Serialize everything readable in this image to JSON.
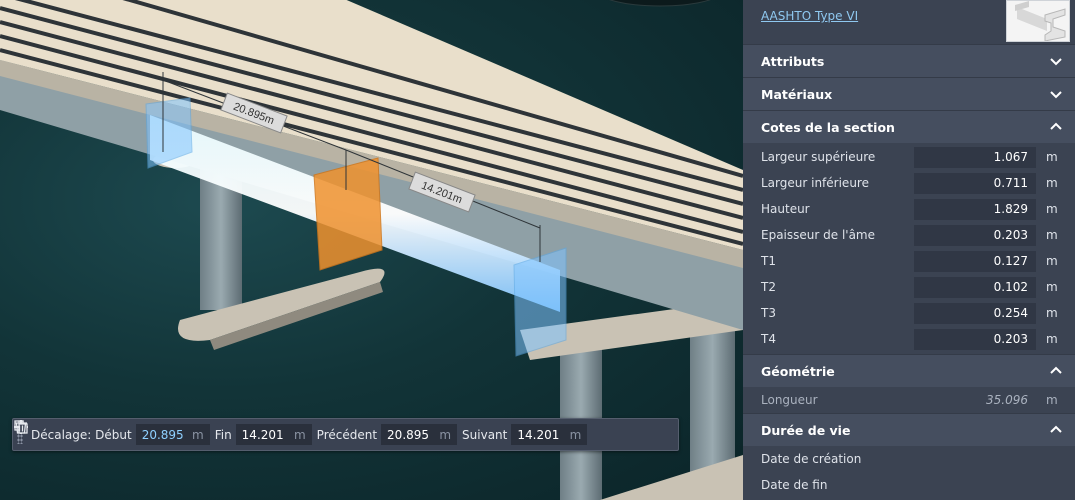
{
  "viewport": {
    "dimension_1": "20.895m",
    "dimension_2": "14.201m"
  },
  "offset_bar": {
    "label_offset": "Décalage:",
    "label_start": "Début",
    "start_value": "20.895",
    "label_end": "Fin",
    "end_value": "14.201",
    "label_prev": "Précédent",
    "prev_value": "20.895",
    "label_next": "Suivant",
    "next_value": "14.201",
    "unit": "m",
    "icons": [
      "plus-icon",
      "copy-icon",
      "trash-icon"
    ]
  },
  "panel": {
    "type_link": "AASHTO Type VI",
    "sections": {
      "attributs": "Attributs",
      "materiaux": "Matériaux",
      "cotes": "Cotes de la section",
      "geometrie": "Géométrie",
      "duree": "Durée de vie"
    },
    "cotes": [
      {
        "label": "Largeur supérieure",
        "value": "1.067",
        "unit": "m"
      },
      {
        "label": "Largeur inférieure",
        "value": "0.711",
        "unit": "m"
      },
      {
        "label": "Hauteur",
        "value": "1.829",
        "unit": "m"
      },
      {
        "label": "Epaisseur de l'âme",
        "value": "0.203",
        "unit": "m"
      },
      {
        "label": "T1",
        "value": "0.127",
        "unit": "m"
      },
      {
        "label": "T2",
        "value": "0.102",
        "unit": "m"
      },
      {
        "label": "T3",
        "value": "0.254",
        "unit": "m"
      },
      {
        "label": "T4",
        "value": "0.203",
        "unit": "m"
      }
    ],
    "geometrie": {
      "label": "Longueur",
      "value": "35.096",
      "unit": "m"
    },
    "duree": {
      "creation": "Date de création",
      "fin": "Date de fin"
    }
  },
  "colors": {
    "panel_bg": "#3b4352",
    "section_header_bg": "#454e5f",
    "link": "#8fc8f0",
    "selected_girder": "#7fc4ff",
    "active_marker": "#f0922e"
  }
}
